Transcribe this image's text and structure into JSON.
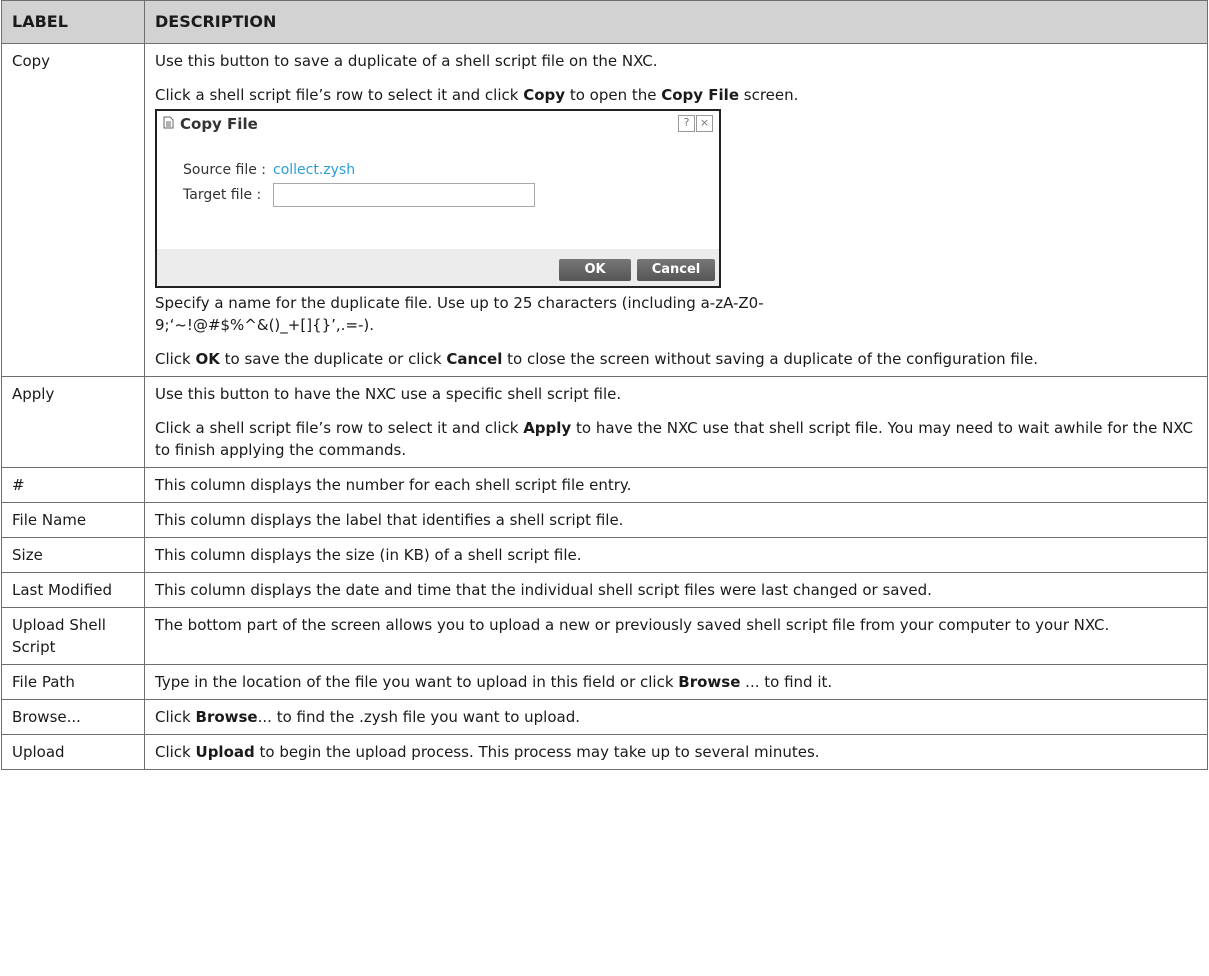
{
  "header": {
    "label": "LABEL",
    "description": "DESCRIPTION"
  },
  "copy": {
    "label": "Copy",
    "p1": "Use this button to save a duplicate of a shell script file on the NXC.",
    "p2_a": "Click a shell script file’s row to select it and click ",
    "p2_b": "Copy",
    "p2_c": " to open the ",
    "p2_d": "Copy File",
    "p2_e": " screen.",
    "dialog": {
      "title": "Copy File",
      "help_icon": "?",
      "close_icon": "×",
      "source_label": "Source file :",
      "source_value": "collect.zysh",
      "target_label": "Target file :",
      "target_value": "",
      "ok": "OK",
      "cancel": "Cancel"
    },
    "p3_line1": "Specify a name for the duplicate file. Use up to 25 characters (including a-zA-Z0-",
    "p3_line2": "9;‘~!@#$%^&()_+[]{}’,.=-).",
    "p4_a": "Click ",
    "p4_b": "OK",
    "p4_c": " to save the duplicate or click ",
    "p4_d": "Cancel",
    "p4_e": " to close the screen without saving a duplicate of the configuration file."
  },
  "apply": {
    "label": "Apply",
    "p1": "Use this button to have the NXC use a specific shell script file.",
    "p2_a": "Click a shell script file’s row to select it and click ",
    "p2_b": "Apply",
    "p2_c": " to have the NXC use that shell script file. You may need to wait awhile for the NXC to finish applying the commands."
  },
  "rows": [
    {
      "label": "#",
      "desc": "This column displays the number for each shell script file entry."
    },
    {
      "label": "File Name",
      "desc": "This column displays the label that identifies a shell script file."
    },
    {
      "label": "Size",
      "desc": "This column displays the size (in KB) of a shell script file."
    },
    {
      "label": "Last Modified",
      "desc": "This column displays the date and time that the individual shell script files were last changed or saved."
    },
    {
      "label": "Upload Shell Script",
      "desc": "The bottom part of the screen allows you to upload a new or previously saved shell script file from your computer to your NXC."
    }
  ],
  "file_path": {
    "label": "File Path",
    "a": "Type in the location of the file you want to upload in this field or click ",
    "b": "Browse",
    "c": " ... to find it."
  },
  "browse": {
    "label": "Browse...",
    "a": "Click ",
    "b": "Browse",
    "c": "... to find the .zysh file you want to upload."
  },
  "upload": {
    "label": "Upload",
    "a": "Click ",
    "b": "Upload",
    "c": " to begin the upload process. This process may take up to several minutes."
  }
}
